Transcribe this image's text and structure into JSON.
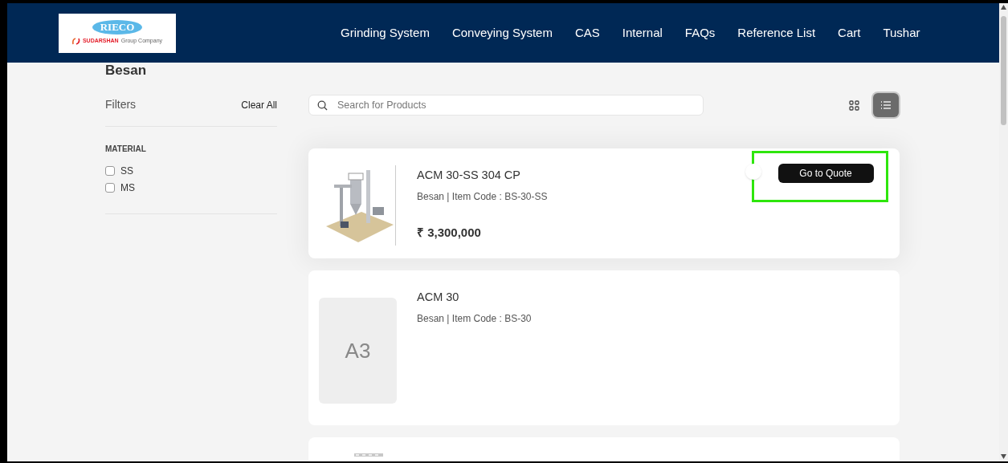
{
  "logo": {
    "brand": "RIECO",
    "tagline_brand": "SUDARSHAN",
    "tagline": "Group Company"
  },
  "nav": [
    "Grinding System",
    "Conveying System",
    "CAS",
    "Internal",
    "FAQs",
    "Reference List",
    "Cart",
    "Tushar"
  ],
  "page_title": "Besan",
  "filters": {
    "title": "Filters",
    "clear": "Clear All",
    "groups": [
      {
        "title": "MATERIAL",
        "options": [
          {
            "label": "SS",
            "checked": false
          },
          {
            "label": "MS",
            "checked": false
          }
        ]
      }
    ]
  },
  "search": {
    "placeholder": "Search for Products"
  },
  "view_toggle": [
    {
      "kind": "grid",
      "selected": false
    },
    {
      "kind": "list",
      "selected": true
    }
  ],
  "products": [
    {
      "image": {
        "kind": "picture"
      },
      "name": "ACM 30-SS 304 CP",
      "meta": "Besan | Item Code : BS-30-SS",
      "price": "₹ 3,300,000",
      "action": "Go to Quote",
      "highlighted": true
    },
    {
      "image": {
        "kind": "initials",
        "text": "A3"
      },
      "name": "ACM 30",
      "meta": "Besan | Item Code : BS-30"
    },
    {
      "image": {
        "kind": "picture"
      }
    }
  ]
}
